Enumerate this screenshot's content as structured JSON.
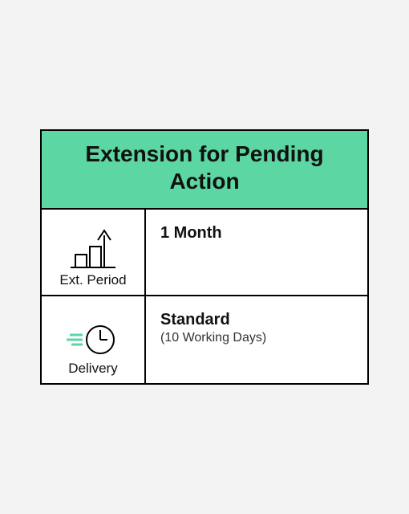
{
  "header": {
    "title": "Extension for Pending Action"
  },
  "rows": [
    {
      "icon_label": "Ext. Period",
      "value_main": "1 Month",
      "value_sub": ""
    },
    {
      "icon_label": "Delivery",
      "value_main": "Standard",
      "value_sub": "(10 Working Days)"
    }
  ]
}
